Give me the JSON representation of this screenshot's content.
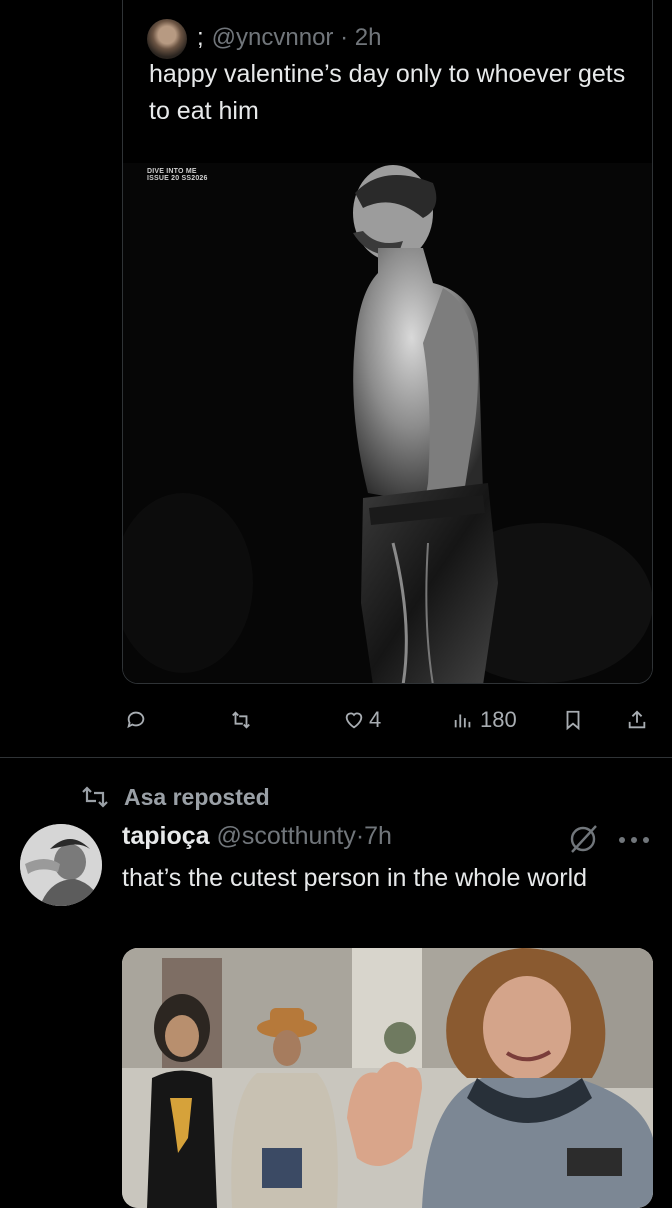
{
  "quoted_tweet": {
    "separator": ";",
    "handle": "@yncvnnor",
    "dot": "·",
    "time": "2h",
    "text": "happy valentine’s day only to whoever gets to eat him",
    "photo_caption_line1": "DIVE INTO ME",
    "photo_caption_line2": "ISSUE 20 SS2026"
  },
  "actions": {
    "likes": "4",
    "views": "180"
  },
  "repost": {
    "label": "Asa reposted"
  },
  "tweet": {
    "name": "tapioça",
    "handle": "@scotthunty",
    "dot": "·",
    "time": "7h",
    "text": "that’s the cutest person in the whole world",
    "photo_badge": "BFGoodrich"
  },
  "colors": {
    "background": "#000000",
    "text": "#e7e9ea",
    "muted": "#71767b",
    "border": "#2f3336"
  }
}
